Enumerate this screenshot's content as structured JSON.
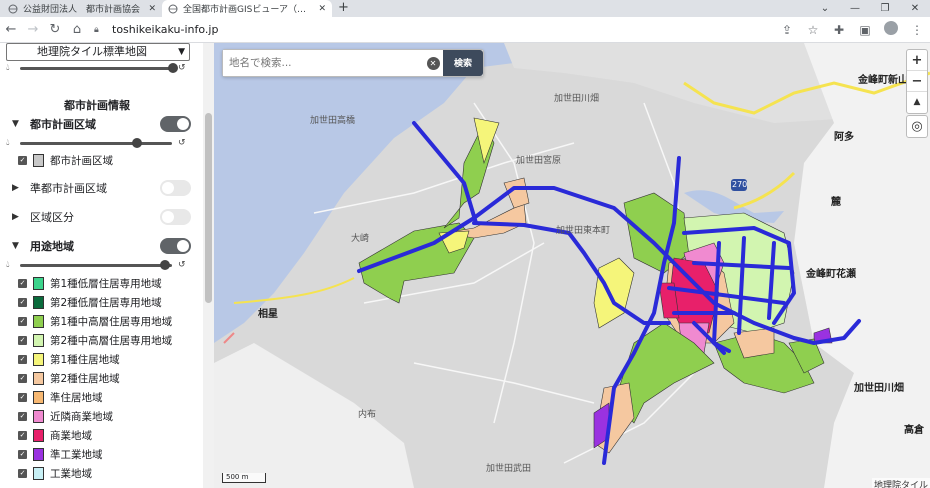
{
  "browser": {
    "tabs": [
      {
        "title": "公益財団法人　都市計画協会",
        "active": false
      },
      {
        "title": "全国都市計画GISビューア（試行版）",
        "active": true
      }
    ],
    "url": "toshikeikaku-info.jp"
  },
  "panel": {
    "basemap_select": "地理院タイル標準地図",
    "section_title": "都市計画情報",
    "layers": [
      {
        "label": "都市計画区域",
        "expanded": true,
        "enabled": true
      },
      {
        "label": "準都市計画区域",
        "expanded": false,
        "enabled": false
      },
      {
        "label": "区域区分",
        "expanded": false,
        "enabled": false
      },
      {
        "label": "用途地域",
        "expanded": true,
        "enabled": true
      }
    ],
    "city_area_legend": {
      "label": "都市計画区域",
      "color": "#c8c8c8"
    },
    "zoning_legend": [
      {
        "label": "第1種低層住居専用地域",
        "color": "#3cd48c"
      },
      {
        "label": "第2種低層住居専用地域",
        "color": "#0a6b3c"
      },
      {
        "label": "第1種中高層住居専用地域",
        "color": "#8fcf4f"
      },
      {
        "label": "第2種中高層住居専用地域",
        "color": "#d2f5b0"
      },
      {
        "label": "第1種住居地域",
        "color": "#f5f57a"
      },
      {
        "label": "第2種住居地域",
        "color": "#f5c8a0"
      },
      {
        "label": "準住居地域",
        "color": "#f7b872"
      },
      {
        "label": "近隣商業地域",
        "color": "#f08ad0"
      },
      {
        "label": "商業地域",
        "color": "#e8206a"
      },
      {
        "label": "準工業地域",
        "color": "#9a32e0"
      },
      {
        "label": "工業地域",
        "color": "#c8f0f5"
      }
    ]
  },
  "map": {
    "search_placeholder": "地名で検索...",
    "search_button": "検索",
    "labels": [
      "加世田高橋",
      "加世田川畑",
      "加世田宮原",
      "加世田東本町",
      "大崎",
      "相星",
      "内布",
      "加世田武田",
      "金峰町花瀬",
      "金峰町新山",
      "阿多",
      "麓",
      "高倉",
      "加世田川畑"
    ],
    "route_number": "270",
    "scale_label": "500 m",
    "attribution": "地理院タイル"
  }
}
